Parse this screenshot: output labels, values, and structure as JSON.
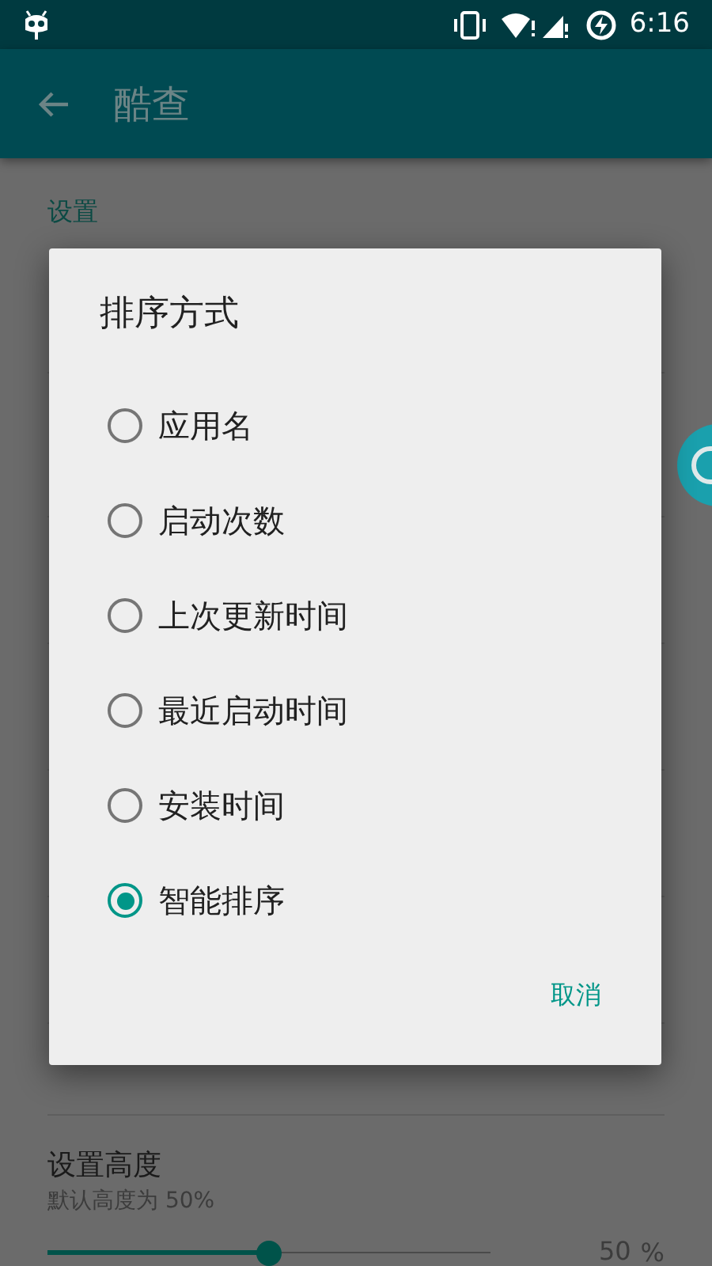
{
  "status_bar": {
    "time": "6:16"
  },
  "app_bar": {
    "title": "酷查"
  },
  "settings": {
    "section_title": "设置",
    "height_setting": {
      "title": "设置高度",
      "summary": "默认高度为 50%",
      "level": 0.5,
      "value": "50",
      "unit": "%"
    }
  },
  "dialog": {
    "title": "排序方式",
    "options": [
      {
        "label": "应用名",
        "selected": false
      },
      {
        "label": "启动次数",
        "selected": false
      },
      {
        "label": "上次更新时间",
        "selected": false
      },
      {
        "label": "最近启动时间",
        "selected": false
      },
      {
        "label": "安装时间",
        "selected": false
      },
      {
        "label": "智能排序",
        "selected": true
      }
    ],
    "cancel": "取消"
  }
}
